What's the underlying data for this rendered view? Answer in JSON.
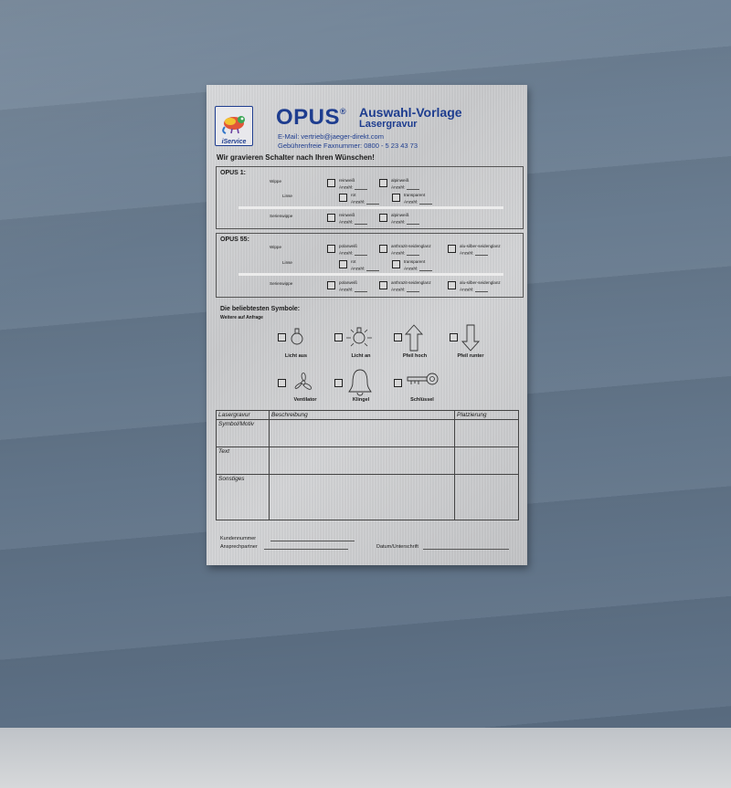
{
  "header": {
    "logo_label": "iService",
    "brand": "OPUS",
    "brand_mark": "®",
    "title": "Auswahl-Vorlage",
    "subtitle": "Lasergravur",
    "email": "E-Mail: vertrieb@jaeger-direkt.com",
    "fax": "Gebührenfreie Faxnummer: 0800 - 5 23 43 73"
  },
  "headline": "Wir gravieren Schalter nach Ihren Wünschen!",
  "sections": [
    {
      "title": "OPUS 1:",
      "rows": [
        {
          "label": "Wippe",
          "options": [
            "reinweiß",
            "alpinweiß"
          ]
        },
        {
          "label": "Linse",
          "options": [
            "rot",
            "transparent"
          ]
        },
        {
          "label": "Serienwippe",
          "options": [
            "reinweiß",
            "alpinweiß"
          ]
        }
      ]
    },
    {
      "title": "OPUS 55:",
      "rows": [
        {
          "label": "Wippe",
          "options": [
            "polarweiß",
            "anthrazit-seidenglanz",
            "alu-silber-seidenglanz"
          ]
        },
        {
          "label": "Linse",
          "options": [
            "rot",
            "transparent"
          ]
        },
        {
          "label": "Serienwippe",
          "options": [
            "polarweiß",
            "anthrazit-seidenglanz",
            "alu-silber-seidenglanz"
          ]
        }
      ]
    }
  ],
  "count_label": "Anzahl:",
  "symbols": {
    "title": "Die beliebtesten Symbole:",
    "subtitle": "Weitere auf Anfrage",
    "items": [
      {
        "label": "Licht aus",
        "icon": "bulb-off-icon"
      },
      {
        "label": "Licht an",
        "icon": "bulb-on-icon"
      },
      {
        "label": "Pfeil hoch",
        "icon": "arrow-up-icon"
      },
      {
        "label": "Pfeil runter",
        "icon": "arrow-down-icon"
      },
      {
        "label": "Ventilator",
        "icon": "fan-icon"
      },
      {
        "label": "Klingel",
        "icon": "bell-icon"
      },
      {
        "label": "Schlüssel",
        "icon": "key-icon"
      }
    ]
  },
  "table": {
    "headers": [
      "Lasergravur",
      "Beschreibung",
      "Platzierung"
    ],
    "rows": [
      "Symbol/Motiv",
      "Text",
      "Sonstiges"
    ]
  },
  "footer": {
    "customer_number": "Kundennummer",
    "contact_person": "Ansprechpartner",
    "date_signature": "Datum/Unterschrift"
  },
  "colors": {
    "brand": "#1e3d8f",
    "wall": "#66798d",
    "sheet": "#d0d1d3"
  }
}
